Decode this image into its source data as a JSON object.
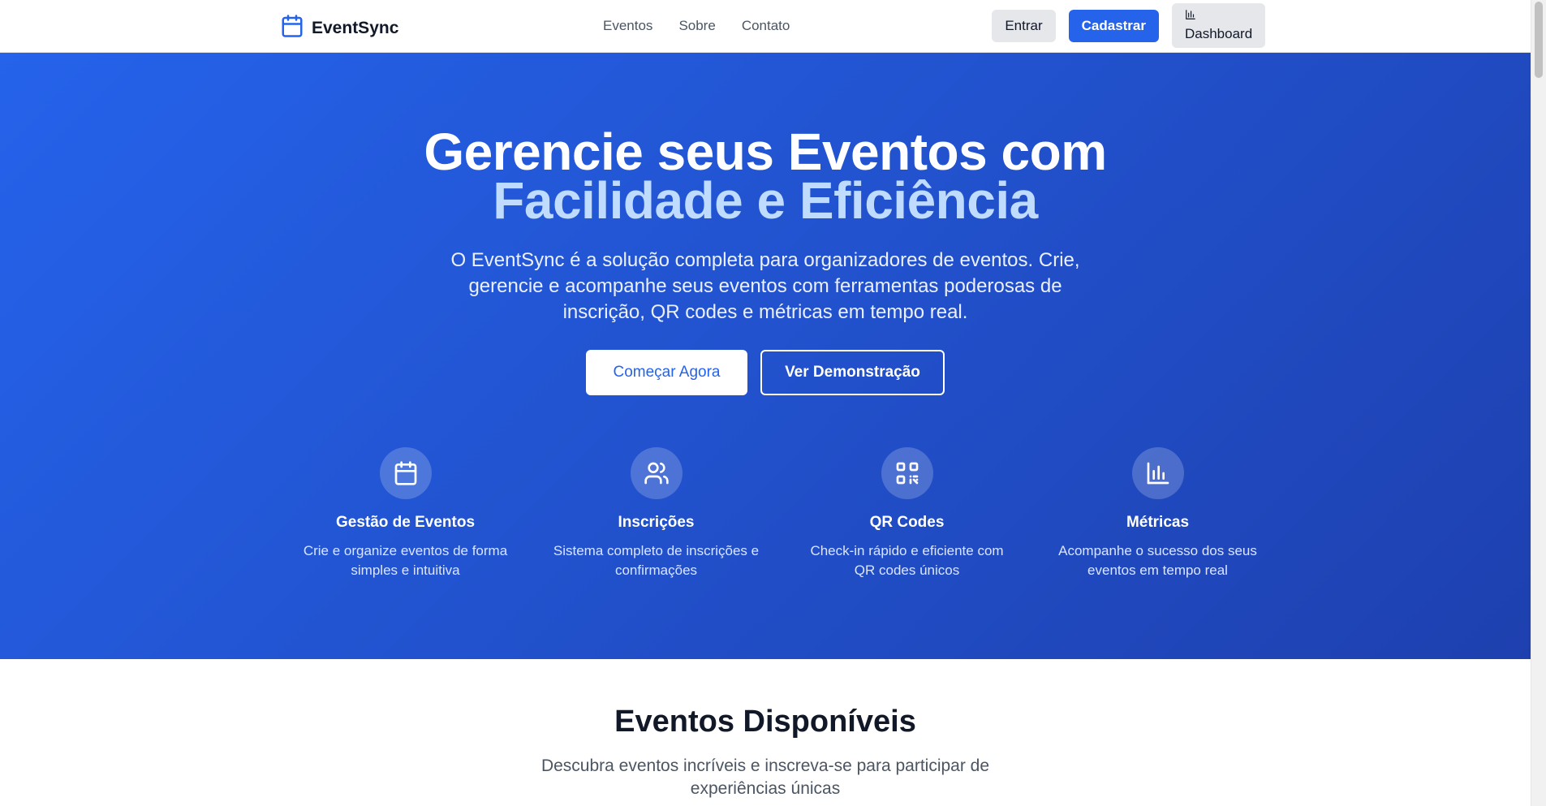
{
  "header": {
    "brand": "EventSync",
    "nav": [
      "Eventos",
      "Sobre",
      "Contato"
    ],
    "login_label": "Entrar",
    "signup_label": "Cadastrar",
    "dashboard_label": "Dashboard"
  },
  "hero": {
    "title_line1": "Gerencie seus Eventos com",
    "title_line2": "Facilidade e Eficiência",
    "lead": "O EventSync é a solução completa para organizadores de eventos. Crie, gerencie e acompanhe seus eventos com ferramentas poderosas de inscrição, QR codes e métricas em tempo real.",
    "primary_cta": "Começar Agora",
    "secondary_cta": "Ver Demonstração"
  },
  "features": [
    {
      "icon": "calendar-icon",
      "title": "Gestão de Eventos",
      "desc": "Crie e organize eventos de forma simples e intuitiva"
    },
    {
      "icon": "users-icon",
      "title": "Inscrições",
      "desc": "Sistema completo de inscrições e confirmações"
    },
    {
      "icon": "qr-code-icon",
      "title": "QR Codes",
      "desc": "Check-in rápido e eficiente com QR codes únicos"
    },
    {
      "icon": "bar-chart-icon",
      "title": "Métricas",
      "desc": "Acompanhe o sucesso dos seus eventos em tempo real"
    }
  ],
  "events": {
    "title": "Eventos Disponíveis",
    "subtitle": "Descubra eventos incríveis e inscreva-se para participar de experiências únicas"
  },
  "colors": {
    "primary": "#2563eb",
    "hero_gradient_end": "#1e40af",
    "accent_text": "#bfdbfe"
  }
}
